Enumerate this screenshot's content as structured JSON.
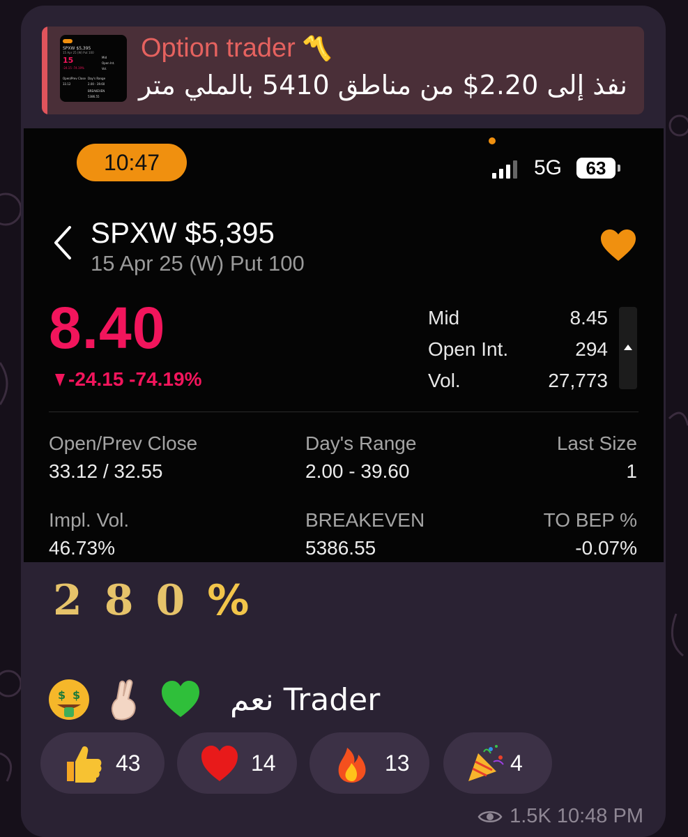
{
  "reply": {
    "author": "Option trader",
    "crown": "〽️",
    "text": "نفذ إلى 2.20$ من مناطق 5410 بالملي متر",
    "thumb": {
      "ticker": "SPXW $5,395",
      "contract": "15 Apr 25 (W) Put 100",
      "price": "15",
      "change": "-24.15 -74.19%",
      "mid": "Mid",
      "open_int": "Open Int.",
      "vol": "Vol.",
      "open_prev": "Open/Prev Close",
      "open_prev_value": "33.12",
      "days_range": "Day's Range",
      "days_range_value": "2.00 - 39.60",
      "breakeven": "BREAKEVEN",
      "breakeven_value": "5386.55"
    }
  },
  "screenshot": {
    "status_bar": {
      "time": "10:47",
      "network": "5G",
      "battery": "63"
    },
    "header": {
      "ticker": "SPXW $5,395",
      "contract": "15 Apr 25 (W) Put 100"
    },
    "quote": {
      "price": "8.40",
      "change": "-24.15 -74.19%"
    },
    "stats": [
      {
        "label": "Mid",
        "value": "8.45"
      },
      {
        "label": "Open Int.",
        "value": "294"
      },
      {
        "label": "Vol.",
        "value": "27,773"
      }
    ],
    "details": {
      "open_prev_label": "Open/Prev Close",
      "open_prev_value": "33.12 / 32.55",
      "days_range_label": "Day's Range",
      "days_range_value": "2.00 - 39.60",
      "last_size_label": "Last Size",
      "last_size_value": "1",
      "impl_vol_label": "Impl. Vol.",
      "impl_vol_value": "46.73%",
      "breakeven_label": "BREAKEVEN",
      "breakeven_value": "5386.55",
      "to_bep_label": "TO BEP %",
      "to_bep_value": "-0.07%"
    },
    "colors": {
      "negative": "#f2155c",
      "accent": "#f0900f"
    }
  },
  "gain": {
    "d1": "2",
    "d2": "8",
    "d3": "0",
    "pct": "%"
  },
  "message": {
    "text": "نعم Trader",
    "emojis": [
      "money-mouth-face-emoji",
      "crossed-fingers-emoji",
      "green-heart-emoji"
    ]
  },
  "reactions": [
    {
      "icon": "thumbs-up-icon",
      "count": "43"
    },
    {
      "icon": "red-heart-icon",
      "count": "14"
    },
    {
      "icon": "fire-icon",
      "count": "13"
    },
    {
      "icon": "party-popper-icon",
      "count": "4"
    }
  ],
  "meta": {
    "views": "1.5K",
    "time": "10:48 PM"
  }
}
